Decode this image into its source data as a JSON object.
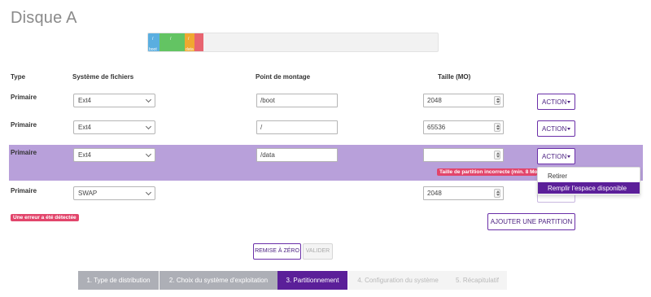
{
  "disk": {
    "title": "Disque A"
  },
  "partition_bar": {
    "segments": [
      {
        "color": "#5aaee0",
        "top_label": "/",
        "bottom_label": "boot"
      },
      {
        "color": "#63c463",
        "top_label": "/",
        "bottom_label": ""
      },
      {
        "color": "#f0a830",
        "top_label": "/",
        "bottom_label": "data"
      },
      {
        "color": "#e86470",
        "top_label": "",
        "bottom_label": ""
      }
    ]
  },
  "table": {
    "headers": {
      "type": "Type",
      "filesystem": "Système de fichiers",
      "mount": "Point de montage",
      "size": "Taille (MO)"
    },
    "rows": [
      {
        "type": "Primaire",
        "filesystem": "Ext4",
        "mount": "/boot",
        "size": "2048",
        "action": "ACTION"
      },
      {
        "type": "Primaire",
        "filesystem": "Ext4",
        "mount": "/",
        "size": "65536",
        "action": "ACTION"
      },
      {
        "type": "Primaire",
        "filesystem": "Ext4",
        "mount": "/data",
        "size": "",
        "action": "ACTION",
        "error": "Taille de partition incorrecte (min. 8 Mo)"
      },
      {
        "type": "Primaire",
        "filesystem": "SWAP",
        "mount": "",
        "size": "2048",
        "action": ""
      }
    ]
  },
  "action_menu": {
    "items": [
      {
        "label": "Retirer"
      },
      {
        "label": "Remplir l'espace disponible"
      }
    ]
  },
  "error_summary": "Une erreur a été détectée",
  "buttons": {
    "add_partition": "AJOUTER UNE PARTITION",
    "reset": "REMISE À ZÉRO",
    "validate": "VALIDER"
  },
  "steps": [
    {
      "label": "1. Type de distribution",
      "state": "done"
    },
    {
      "label": "2. Choix du système d'exploitation",
      "state": "done"
    },
    {
      "label": "3. Partitionnement",
      "state": "current"
    },
    {
      "label": "4. Configuration du système",
      "state": "todo"
    },
    {
      "label": "5. Récapitulatif",
      "state": "todo"
    }
  ],
  "colors": {
    "accent": "#5b1f99",
    "row_highlight": "#b8a0da",
    "error": "#e2456b",
    "step_done": "#adafb6"
  }
}
